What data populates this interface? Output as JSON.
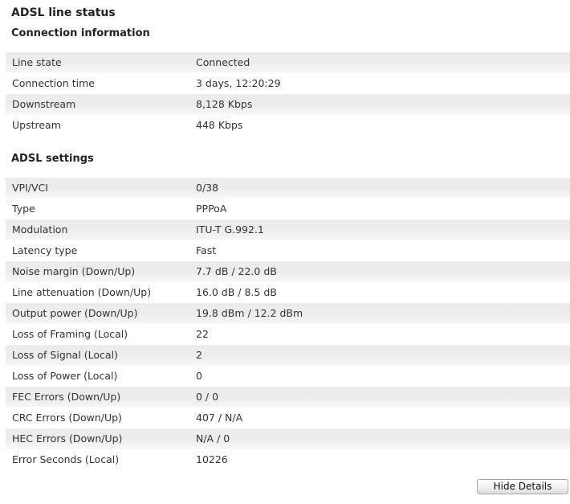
{
  "page_title": "ADSL line status",
  "connection": {
    "heading": "Connection information",
    "rows": [
      {
        "label": "Line state",
        "value": "Connected"
      },
      {
        "label": "Connection time",
        "value": "3 days, 12:20:29"
      },
      {
        "label": "Downstream",
        "value": "8,128 Kbps"
      },
      {
        "label": "Upstream",
        "value": "448 Kbps"
      }
    ]
  },
  "adsl": {
    "heading": "ADSL settings",
    "rows": [
      {
        "label": "VPI/VCI",
        "value": "0/38"
      },
      {
        "label": "Type",
        "value": "PPPoA"
      },
      {
        "label": "Modulation",
        "value": "ITU-T G.992.1"
      },
      {
        "label": "Latency type",
        "value": "Fast"
      },
      {
        "label": "Noise margin (Down/Up)",
        "value": "7.7 dB / 22.0 dB"
      },
      {
        "label": "Line attenuation (Down/Up)",
        "value": "16.0 dB / 8.5 dB"
      },
      {
        "label": "Output power (Down/Up)",
        "value": "19.8 dBm / 12.2 dBm"
      },
      {
        "label": "Loss of Framing (Local)",
        "value": "22"
      },
      {
        "label": "Loss of Signal (Local)",
        "value": "2"
      },
      {
        "label": "Loss of Power (Local)",
        "value": "0"
      },
      {
        "label": "FEC Errors (Down/Up)",
        "value": "0 / 0"
      },
      {
        "label": "CRC Errors (Down/Up)",
        "value": "407 / N/A"
      },
      {
        "label": "HEC Errors (Down/Up)",
        "value": "N/A / 0"
      },
      {
        "label": "Error Seconds (Local)",
        "value": "10226"
      }
    ]
  },
  "buttons": {
    "hide_details": "Hide Details"
  }
}
